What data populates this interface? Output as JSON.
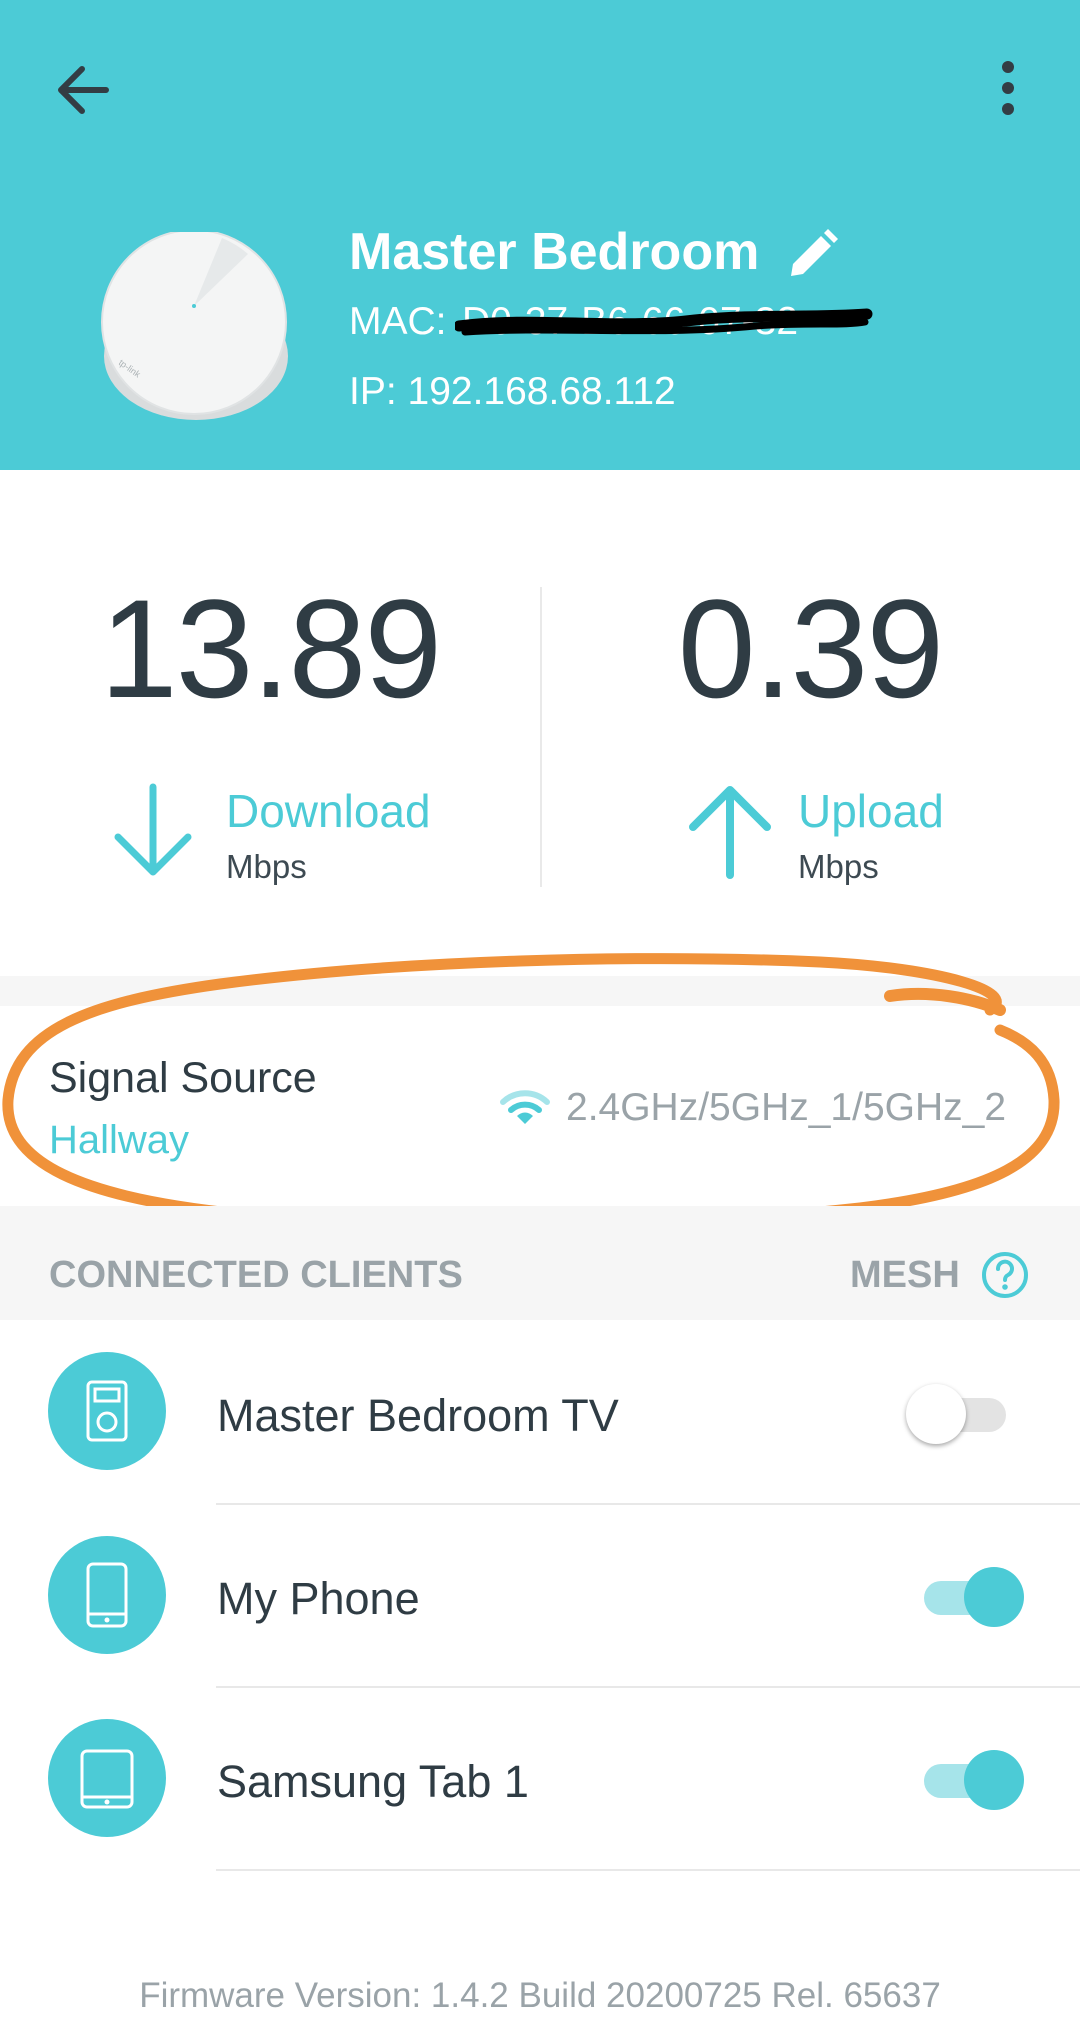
{
  "header": {
    "device_name": "Master Bedroom",
    "mac_label": "MAC:",
    "mac_value": "D0-37-B6-66-07-32",
    "ip_label": "IP: 192.168.68.112"
  },
  "speeds": {
    "download": {
      "value": "13.89",
      "label": "Download",
      "unit": "Mbps"
    },
    "upload": {
      "value": "0.39",
      "label": "Upload",
      "unit": "Mbps"
    }
  },
  "signal": {
    "title": "Signal Source",
    "source": "Hallway",
    "bands": "2.4GHz/5GHz_1/5GHz_2"
  },
  "clients_section": {
    "title": "CONNECTED CLIENTS",
    "mesh_label": "MESH"
  },
  "clients": [
    {
      "name": "Master Bedroom TV",
      "icon": "media-player-icon",
      "enabled": false
    },
    {
      "name": "My Phone",
      "icon": "phone-icon",
      "enabled": true
    },
    {
      "name": "Samsung Tab 1",
      "icon": "tablet-icon",
      "enabled": true
    }
  ],
  "footer": {
    "firmware": "Firmware Version: 1.4.2 Build 20200725 Rel. 65637"
  },
  "colors": {
    "accent": "#4ccbd6",
    "annotation_circle": "#f0923a",
    "text_dark": "#2f3c44",
    "text_muted": "#9aa3a8"
  }
}
